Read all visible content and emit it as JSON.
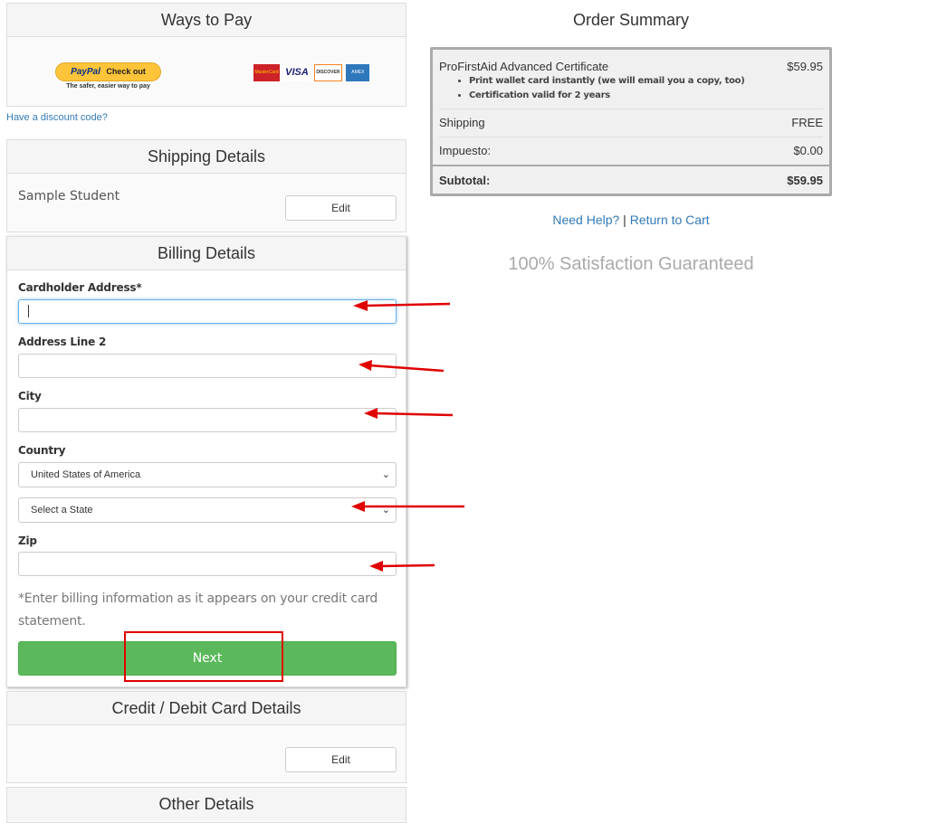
{
  "ways_to_pay": {
    "title": "Ways to Pay",
    "paypal_word": "PayPal",
    "paypal_checkout": "Check out",
    "paypal_tagline": "The safer, easier way to pay",
    "cards": [
      "MasterCard",
      "VISA",
      "DISCOVER",
      "AMEX"
    ],
    "discount_link": "Have a discount code?"
  },
  "shipping": {
    "title": "Shipping Details",
    "name": "Sample Student",
    "edit_label": "Edit"
  },
  "billing": {
    "title": "Billing Details",
    "address_label": "Cardholder Address*",
    "address_value": "",
    "address2_label": "Address Line 2",
    "address2_value": "",
    "city_label": "City",
    "city_value": "",
    "country_label": "Country",
    "country_value": "United States of America",
    "state_value": "Select a State",
    "zip_label": "Zip",
    "zip_value": "",
    "note": "*Enter billing information as it appears on your credit card statement.",
    "next_label": "Next",
    "accent": "#5cb85c"
  },
  "card_details": {
    "title": "Credit / Debit Card Details",
    "edit_label": "Edit"
  },
  "other_details": {
    "title": "Other Details"
  },
  "order_summary": {
    "title": "Order Summary",
    "product": "ProFirstAid Advanced Certificate",
    "product_price": "$59.95",
    "bullets": [
      "Print wallet card instantly (we will email you a copy, too)",
      "Certification valid for 2 years"
    ],
    "shipping_label": "Shipping",
    "shipping_value": "FREE",
    "tax_label": "Impuesto:",
    "tax_value": "$0.00",
    "subtotal_label": "Subtotal:",
    "subtotal_value": "$59.95"
  },
  "help": {
    "need_help": "Need Help?",
    "separator": "|",
    "return_to_cart": "Return to Cart"
  },
  "guarantee": "100% Satisfaction Guaranteed",
  "annotation_color": "#e00000"
}
